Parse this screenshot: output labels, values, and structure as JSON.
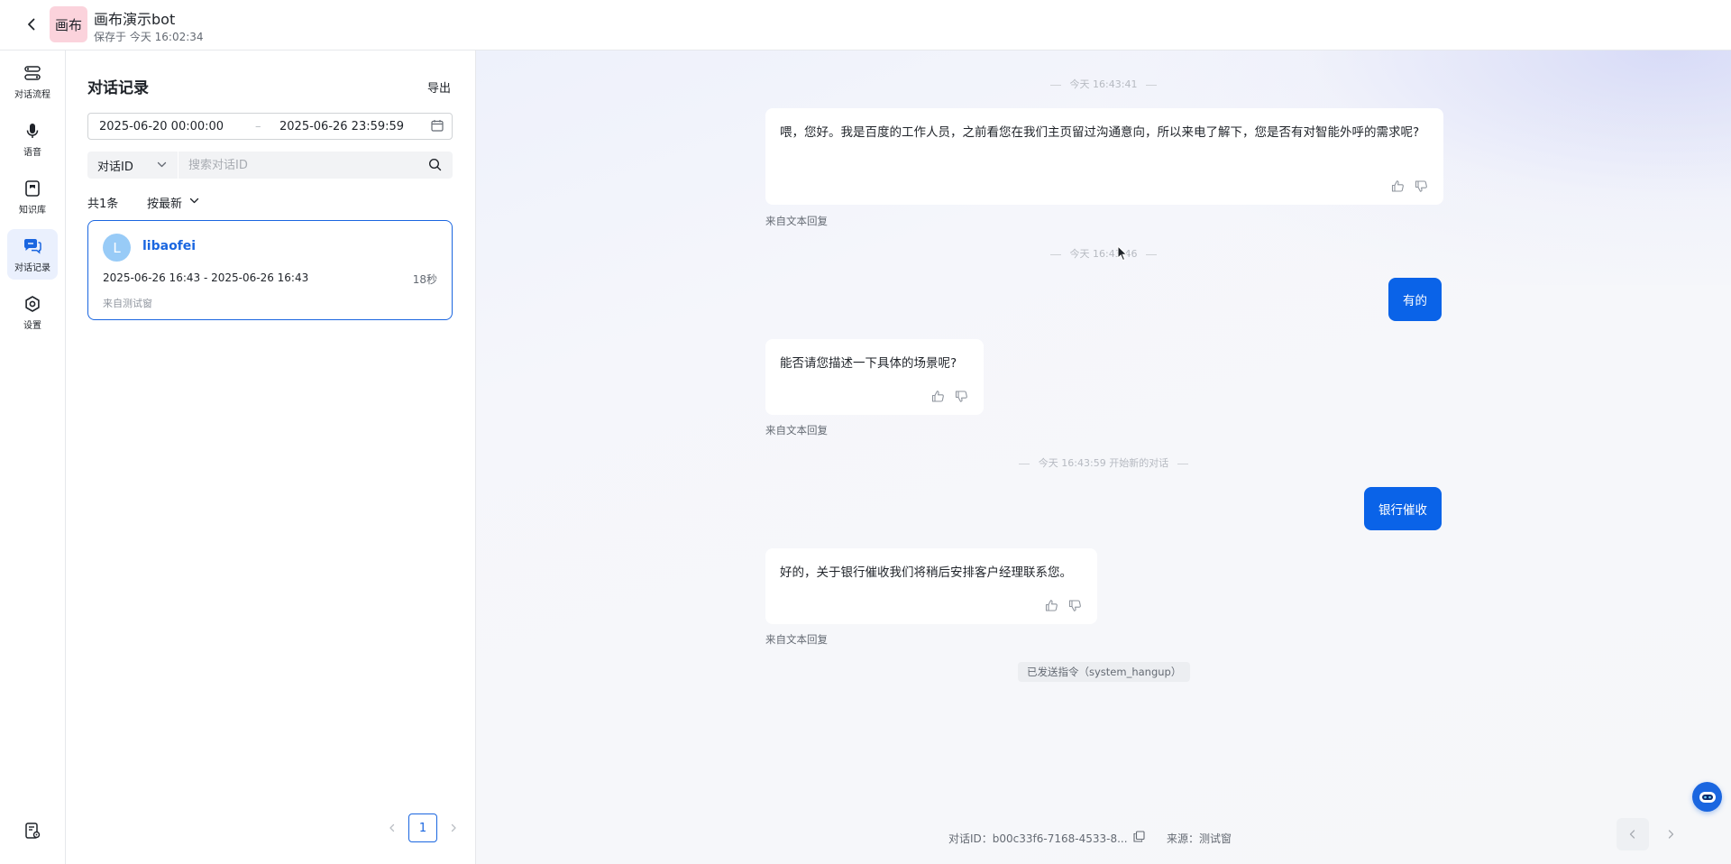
{
  "topbar": {
    "logo_text": "画布",
    "title": "画布演示bot",
    "saved": "保存于 今天 16:02:34"
  },
  "leftnav": {
    "items": [
      {
        "label": "对话流程",
        "icon": "flow-icon"
      },
      {
        "label": "语音",
        "icon": "microphone-icon"
      },
      {
        "label": "知识库",
        "icon": "knowledge-icon"
      },
      {
        "label": "对话记录",
        "icon": "chat-history-icon",
        "active": true
      },
      {
        "label": "设置",
        "icon": "gear-icon"
      }
    ]
  },
  "panel": {
    "title": "对话记录",
    "export_label": "导出",
    "date_start": "2025-06-20 00:00:00",
    "date_sep": "–",
    "date_end": "2025-06-26 23:59:59",
    "filter_select": "对话ID",
    "search_placeholder": "搜索对话ID",
    "count": "共1条",
    "sort_label": "按最新",
    "conversations": [
      {
        "avatar": "L",
        "name": "libaofei",
        "time_range": "2025-06-26 16:43 - 2025-06-26 16:43",
        "duration": "18秒",
        "source": "来自测试窗"
      }
    ],
    "page": "1"
  },
  "chat": {
    "ts1": "今天 16:43:41",
    "bot1": "喂，您好。我是百度的工作人员，之前看您在我们主页留过沟通意向，所以来电了解下，您是否有对智能外呼的需求呢?",
    "src1": "来自文本回复",
    "ts2": "今天 16:43:46",
    "user1": "有的",
    "bot2": "能否请您描述一下具体的场景呢?",
    "src2": "来自文本回复",
    "ts3": "今天 16:43:59 开始新的对话",
    "user2": "银行催收",
    "bot3": "好的，关于银行催收我们将稍后安排客户经理联系您。",
    "src3": "来自文本回复",
    "system_cmd": "已发送指令（system_hangup）",
    "footer_id": "对话ID：b00c33f6-7168-4533-8...",
    "footer_src": "来源：测试窗"
  },
  "colors": {
    "accent": "#1a66e0",
    "user_bubble": "#0a63e8",
    "avatar_bg": "#98cbf7",
    "logo_bg": "#fbd3dc"
  }
}
